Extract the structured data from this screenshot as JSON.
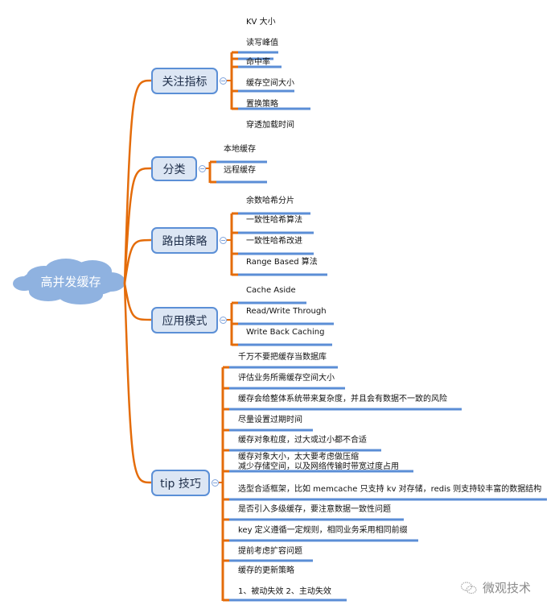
{
  "colors": {
    "connector": "#e46c0a",
    "underline": "#5b8ed6",
    "node_fill": "#dce6f4",
    "node_border": "#5b8fd6",
    "cloud_fill": "#8fb2e0",
    "root_text": "#ffffff"
  },
  "root": {
    "label": "高并发缓存",
    "shape": "cloud"
  },
  "branches": [
    {
      "label": "关注指标",
      "children": [
        "KV 大小",
        "读写峰值",
        "命中率",
        "缓存空间大小",
        "置换策略",
        "穿透加载时间"
      ]
    },
    {
      "label": "分类",
      "children": [
        "本地缓存",
        "远程缓存"
      ]
    },
    {
      "label": "路由策略",
      "children": [
        "余数哈希分片",
        "一致性哈希算法",
        "一致性哈希改进",
        "Range Based 算法"
      ]
    },
    {
      "label": "应用模式",
      "children": [
        "Cache Aside",
        "Read/Write Through",
        "Write Back Caching"
      ]
    },
    {
      "label": "tip 技巧",
      "children": [
        "千万不要把缓存当数据库",
        "评估业务所需缓存空间大小",
        "缓存会给整体系统带来复杂度，并且会有数据不一致的风险",
        "尽量设置过期时间",
        "缓存对象粒度，过大或过小都不合适",
        "缓存对象大小，太大要考虑做压缩\n减少存储空间，以及网络传输时带宽过度占用",
        "选型合适框架，比如 memcache 只支持 kv 对存储，redis 则支持较丰富的数据结构",
        "是否引入多级缓存，要注意数据一致性问题",
        "key 定义遵循一定规则，相同业务采用相同前缀",
        "提前考虑扩容问题",
        "缓存的更新策略\n1、被动失效  2、主动失效"
      ]
    }
  ],
  "watermark": {
    "label": "微观技术",
    "icon": "wechat-icon"
  }
}
